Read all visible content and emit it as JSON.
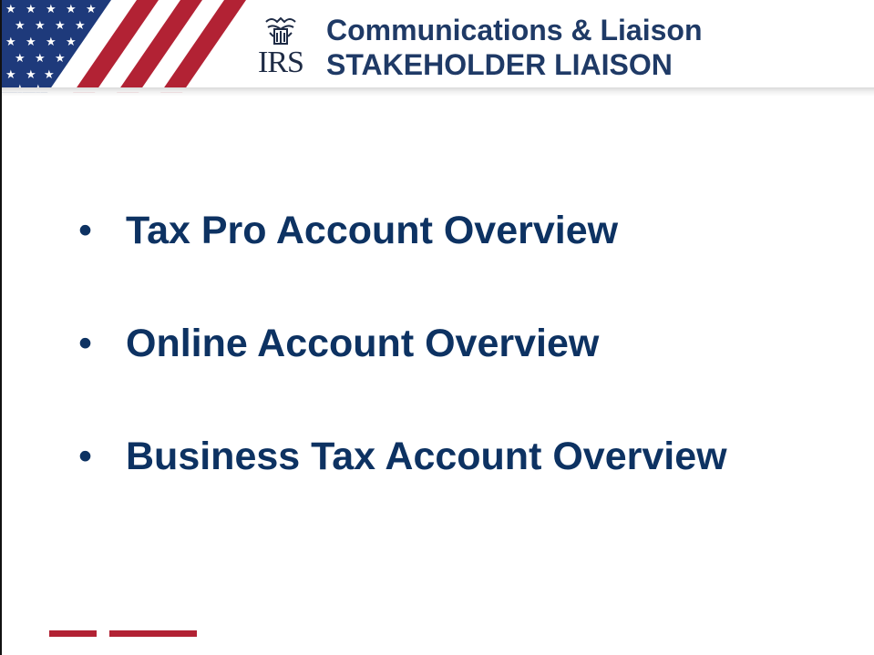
{
  "header": {
    "logo_text": "IRS",
    "title_line1": "Communications & Liaison",
    "title_line2": "STAKEHOLDER LIAISON"
  },
  "content": {
    "bullet_symbol": "•",
    "items": [
      {
        "label": "Tax Pro Account Overview"
      },
      {
        "label": "Online Account Overview"
      },
      {
        "label": "Business Tax Account Overview"
      }
    ]
  },
  "colors": {
    "title_navy": "#1f3a66",
    "bullet_navy": "#0d3262",
    "flag_red": "#b22234",
    "flag_blue": "#1e3a7b",
    "accent_red": "#b22234"
  }
}
